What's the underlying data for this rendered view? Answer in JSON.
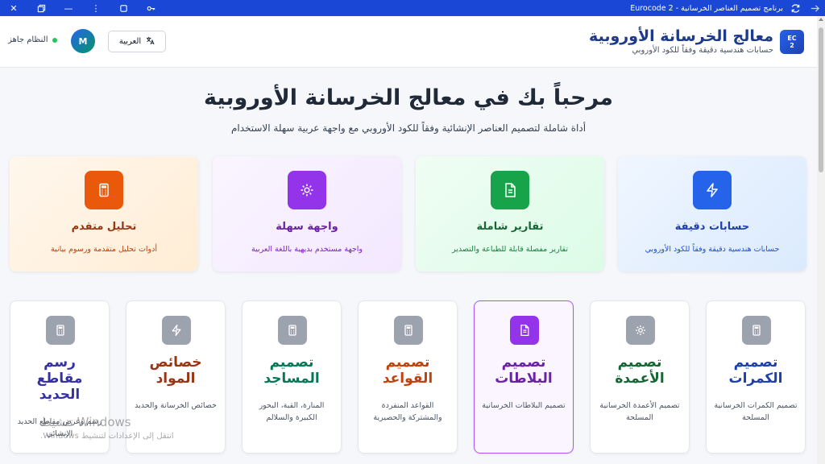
{
  "titlebar": {
    "title": "برنامج تصميم العناصر الخرسانية - Eurocode 2"
  },
  "header": {
    "logo_line1": "EC",
    "logo_line2": "2",
    "app_title": "معالج الخرسانة الأوروبية",
    "app_subtitle": "حسابات هندسية دقيقة وفقاً للكود الأوروبي",
    "language_label": "العربية",
    "avatar_letter": "M",
    "status_text": "النظام جاهز",
    "status_color": "#22c55e"
  },
  "hero": {
    "title": "مرحباً بك في معالج الخرسانة الأوروبية",
    "subtitle": "أداة شاملة لتصميم العناصر الإنشائية وفقاً للكود الأوروبي مع واجهة عربية سهلة الاستخدام"
  },
  "features": [
    {
      "title": "حسابات دقيقة",
      "desc": "حسابات هندسية دقيقة وفقاً للكود الأوروبي",
      "icon": "lightning-icon",
      "color": "#2563eb"
    },
    {
      "title": "تقارير شاملة",
      "desc": "تقارير مفصلة قابلة للطباعة والتصدير",
      "icon": "document-icon",
      "color": "#16a34a"
    },
    {
      "title": "واجهة سهلة",
      "desc": "واجهة مستخدم بديهية باللغة العربية",
      "icon": "gear-icon",
      "color": "#9333ea"
    },
    {
      "title": "تحليل متقدم",
      "desc": "أدوات تحليل متقدمة ورسوم بيانية",
      "icon": "calculator-icon",
      "color": "#ea580c"
    }
  ],
  "modules": [
    {
      "title": "تصميم الكمرات",
      "desc": "تصميم الكمرات الخرسانية المسلحة",
      "icon": "calculator-icon",
      "color": "#1e40af"
    },
    {
      "title": "تصميم الأعمدة",
      "desc": "تصميم الأعمدة الخرسانية المسلحة",
      "icon": "gear-icon",
      "color": "#166534"
    },
    {
      "title": "تصميم البلاطات",
      "desc": "تصميم البلاطات الخرسانية",
      "icon": "document-icon",
      "color": "#6b21a8"
    },
    {
      "title": "تصميم القواعد",
      "desc": "القواعد المنفردة والمشتركة والحصيرية",
      "icon": "calculator-icon",
      "color": "#c2410c"
    },
    {
      "title": "تصميم المساجد",
      "desc": "المنارة، القبة، البحور الكبيرة والسلالم",
      "icon": "calculator-icon",
      "color": "#047857"
    },
    {
      "title": "خصائص المواد",
      "desc": "خصائص الخرسانة والحديد",
      "icon": "lightning-icon",
      "color": "#9a3412"
    },
    {
      "title": "رسم مقاطع الحديد",
      "desc": "رسم وعرض مقاطع الحديد الإنشائي",
      "icon": "calculator-icon",
      "color": "#3730a3"
    }
  ],
  "watermark": {
    "line1": "تنشيط Windows",
    "line2": "انتقل إلى الإعدادات لتنشيط Windows."
  }
}
